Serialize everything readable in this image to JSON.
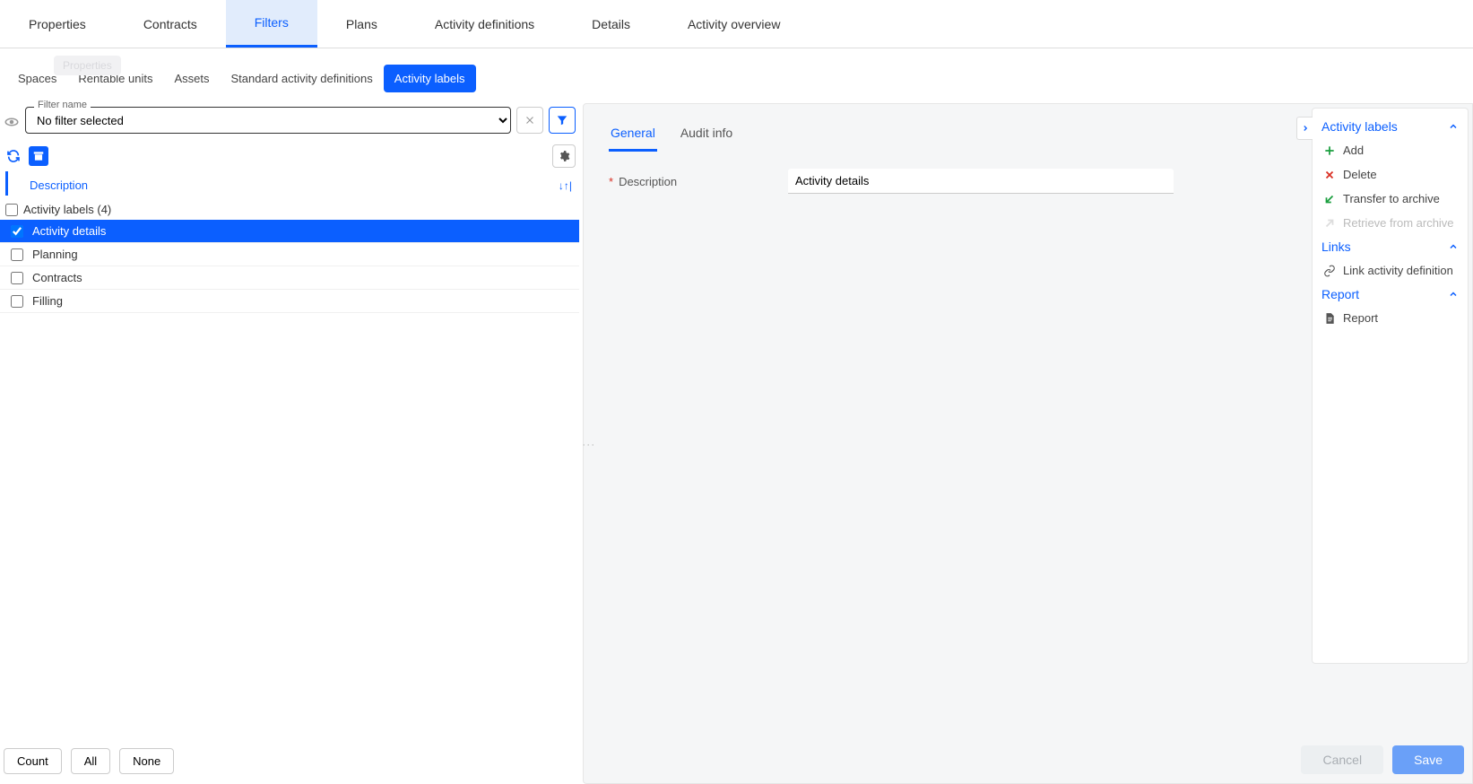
{
  "topTabs": {
    "items": [
      "Properties",
      "Contracts",
      "Filters",
      "Plans",
      "Activity definitions",
      "Details",
      "Activity overview"
    ],
    "activeIndex": 2
  },
  "ghostPill": "Properties",
  "subTabs": {
    "items": [
      "Spaces",
      "Rentable units",
      "Assets",
      "Standard activity definitions",
      "Activity labels"
    ],
    "activeIndex": 4
  },
  "filter": {
    "label": "Filter name",
    "selected": "No filter selected"
  },
  "columnHeader": "Description",
  "tree": {
    "groupLabel": "Activity labels (4)",
    "items": [
      {
        "label": "Activity details",
        "selected": true
      },
      {
        "label": "Planning",
        "selected": false
      },
      {
        "label": "Contracts",
        "selected": false
      },
      {
        "label": "Filling",
        "selected": false
      }
    ]
  },
  "detail": {
    "tabs": {
      "items": [
        "General",
        "Audit info"
      ],
      "activeIndex": 0
    },
    "descriptionLabel": "Description",
    "descriptionValue": "Activity details"
  },
  "actionPanel": {
    "section1": "Activity labels",
    "add": "Add",
    "delete": "Delete",
    "transfer": "Transfer to archive",
    "retrieve": "Retrieve from archive",
    "section2": "Links",
    "link": "Link activity definition",
    "section3": "Report",
    "report": "Report"
  },
  "footerLeft": {
    "count": "Count",
    "all": "All",
    "none": "None"
  },
  "footerRight": {
    "cancel": "Cancel",
    "save": "Save"
  }
}
